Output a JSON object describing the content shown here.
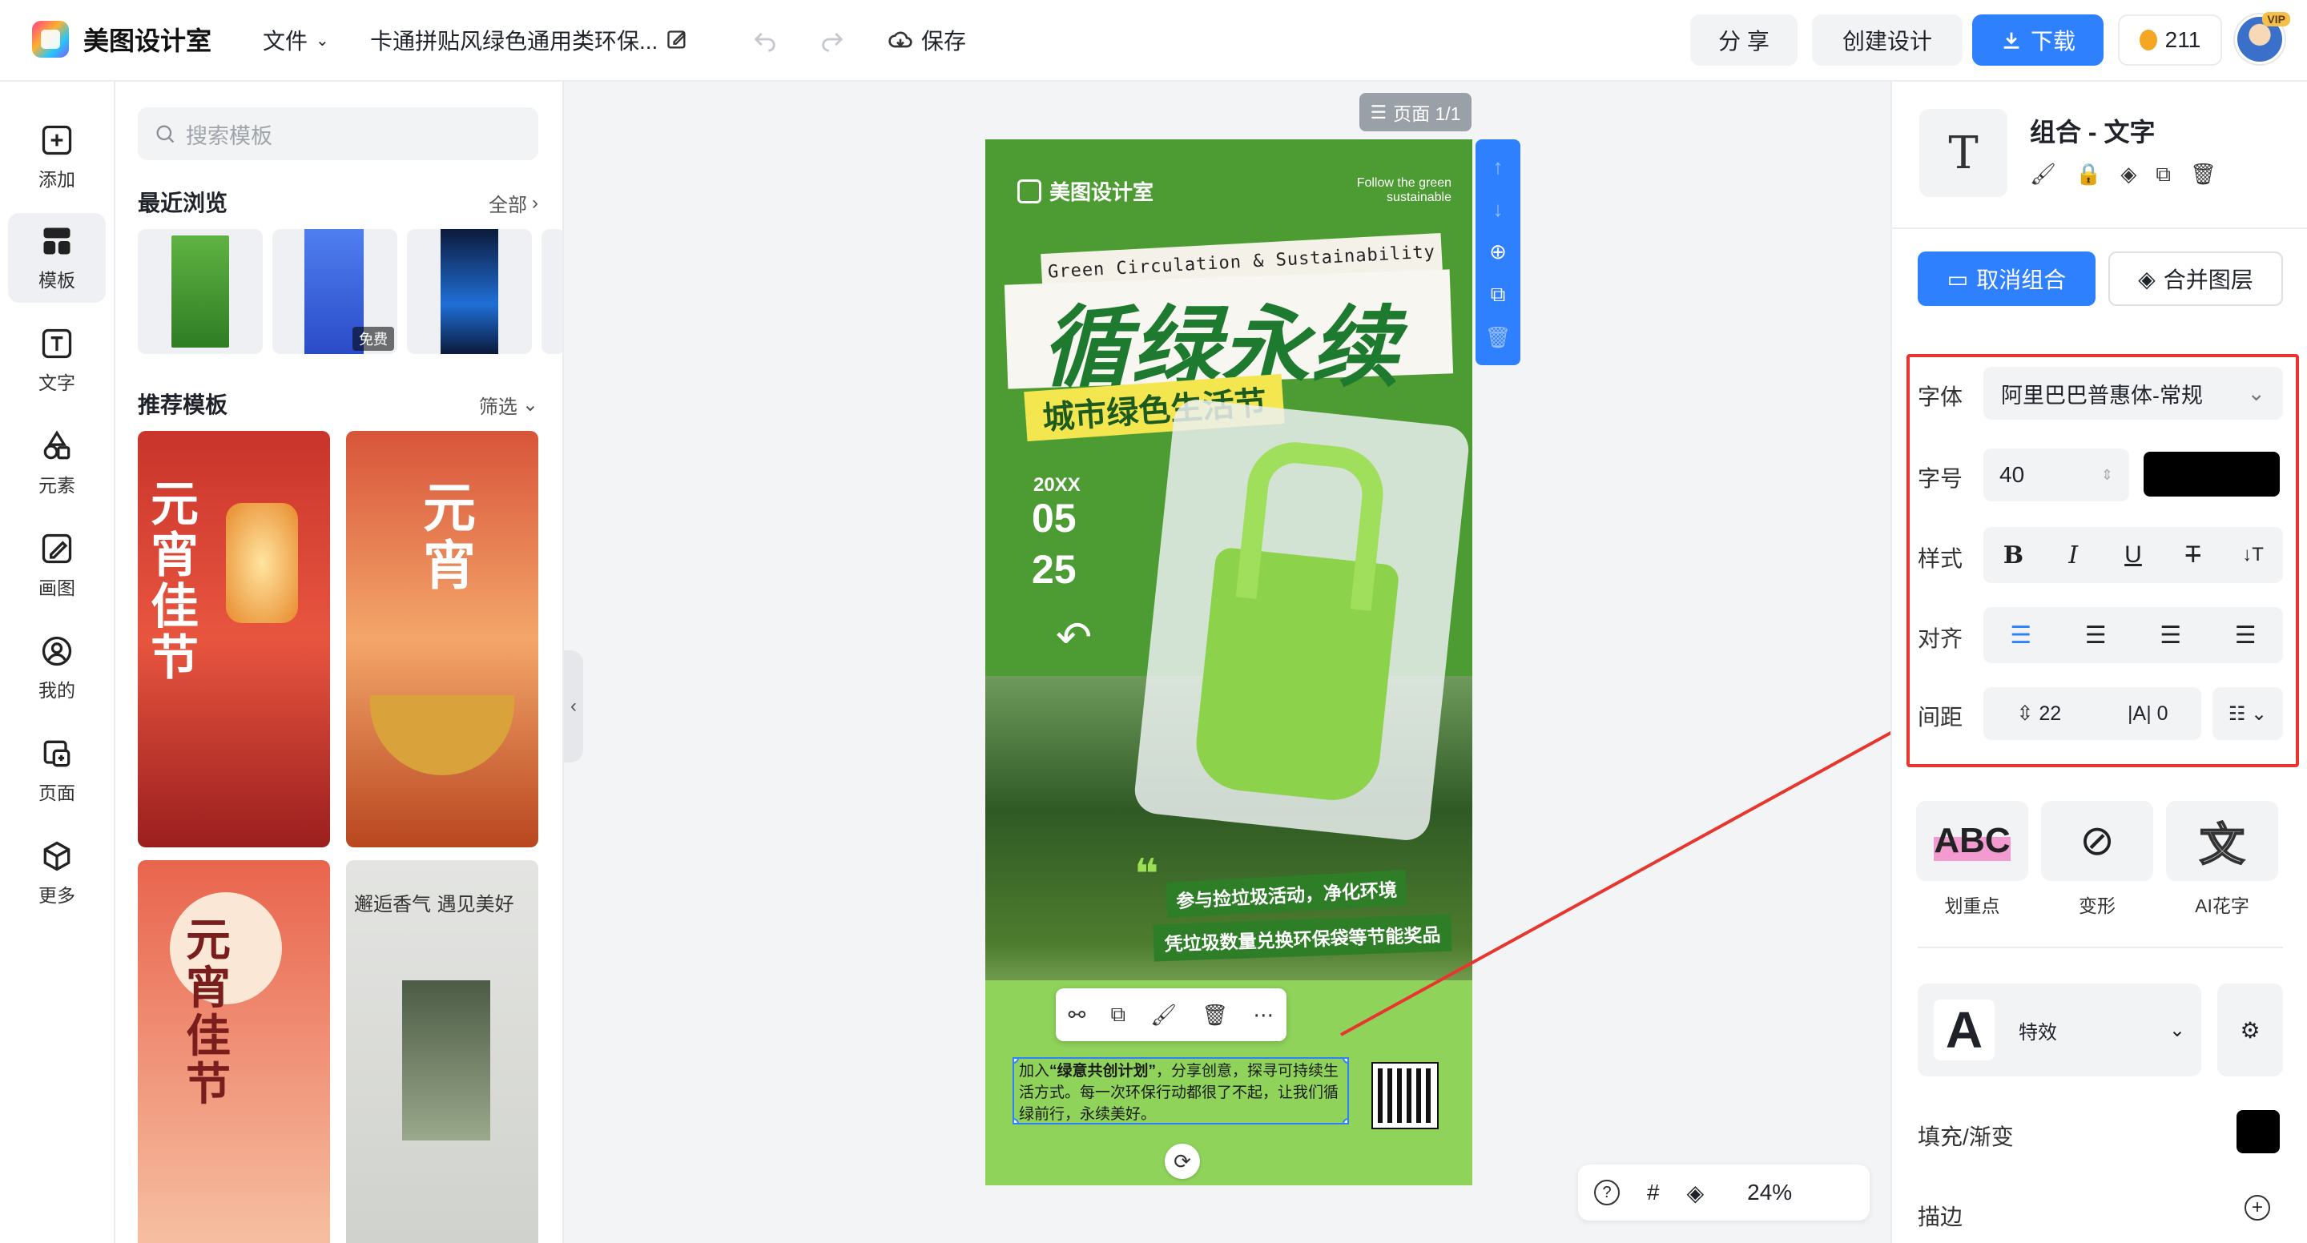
{
  "app": {
    "name": "美图设计室"
  },
  "topbar": {
    "file_menu": "文件",
    "doc_title": "卡通拼贴风绿色通用类环保...",
    "save_label": "保存",
    "share_label": "分 享",
    "create_label": "创建设计",
    "download_label": "下载",
    "points": "211",
    "vip_badge": "VIP"
  },
  "leftnav": {
    "items": [
      {
        "label": "添加",
        "icon": "plus-square-icon"
      },
      {
        "label": "模板",
        "icon": "template-icon"
      },
      {
        "label": "文字",
        "icon": "text-icon"
      },
      {
        "label": "元素",
        "icon": "shapes-icon"
      },
      {
        "label": "画图",
        "icon": "draw-icon"
      },
      {
        "label": "我的",
        "icon": "user-icon"
      },
      {
        "label": "页面",
        "icon": "page-icon"
      },
      {
        "label": "更多",
        "icon": "cube-icon"
      }
    ]
  },
  "panel": {
    "search_placeholder": "搜索模板",
    "recent_title": "最近浏览",
    "recent_link": "全部",
    "recent_free_badge": "免费",
    "recommend_title": "推荐模板",
    "recommend_link": "筛选",
    "templates": [
      {
        "title": "元宵佳节"
      },
      {
        "title": "元宵"
      },
      {
        "title": "元宵佳节"
      },
      {
        "title": "邂逅香气 遇见美好"
      }
    ]
  },
  "canvas": {
    "page_indicator": "页面 1/1",
    "zoom": "24%",
    "poster": {
      "brand": "美图设计室",
      "tagline": "Follow the green sustainable",
      "subtitle_en": "Green Circulation & Sustainability",
      "headline": "循绿永续",
      "sub_headline": "城市绿色生活节",
      "year": "20XX",
      "month": "05",
      "day": "25",
      "line1": "参与捡垃圾活动，净化环境",
      "line2": "凭垃圾数量兑换环保袋等节能奖品",
      "body_text": "加入“绿意共创计划”，分享创意，探寻可持续生活方式。每一次环保行动都很了不起，让我们循绿前行，永续美好。",
      "body_bold": "“绿意共创计划”"
    }
  },
  "rightpanel": {
    "title": "组合 - 文字",
    "ungroup_label": "取消组合",
    "merge_label": "合并图层",
    "font_label": "字体",
    "font_value": "阿里巴巴普惠体-常规",
    "size_label": "字号",
    "size_value": "40",
    "text_color": "#000000",
    "style_label": "样式",
    "align_label": "对齐",
    "spacing_label": "间距",
    "line_spacing": "22",
    "letter_spacing": "0",
    "effects": [
      {
        "label": "划重点",
        "preview": "ABC"
      },
      {
        "label": "变形",
        "preview": "⊘"
      },
      {
        "label": "AI花字",
        "preview": "文"
      }
    ],
    "special_label": "特效",
    "special_preview": "A",
    "fill_label": "填充/渐变",
    "fill_color": "#000000",
    "stroke_label": "描边"
  },
  "colors": {
    "accent": "#2f80ff",
    "highlight_box": "#e8362f",
    "poster_green": "#4c9c33"
  }
}
